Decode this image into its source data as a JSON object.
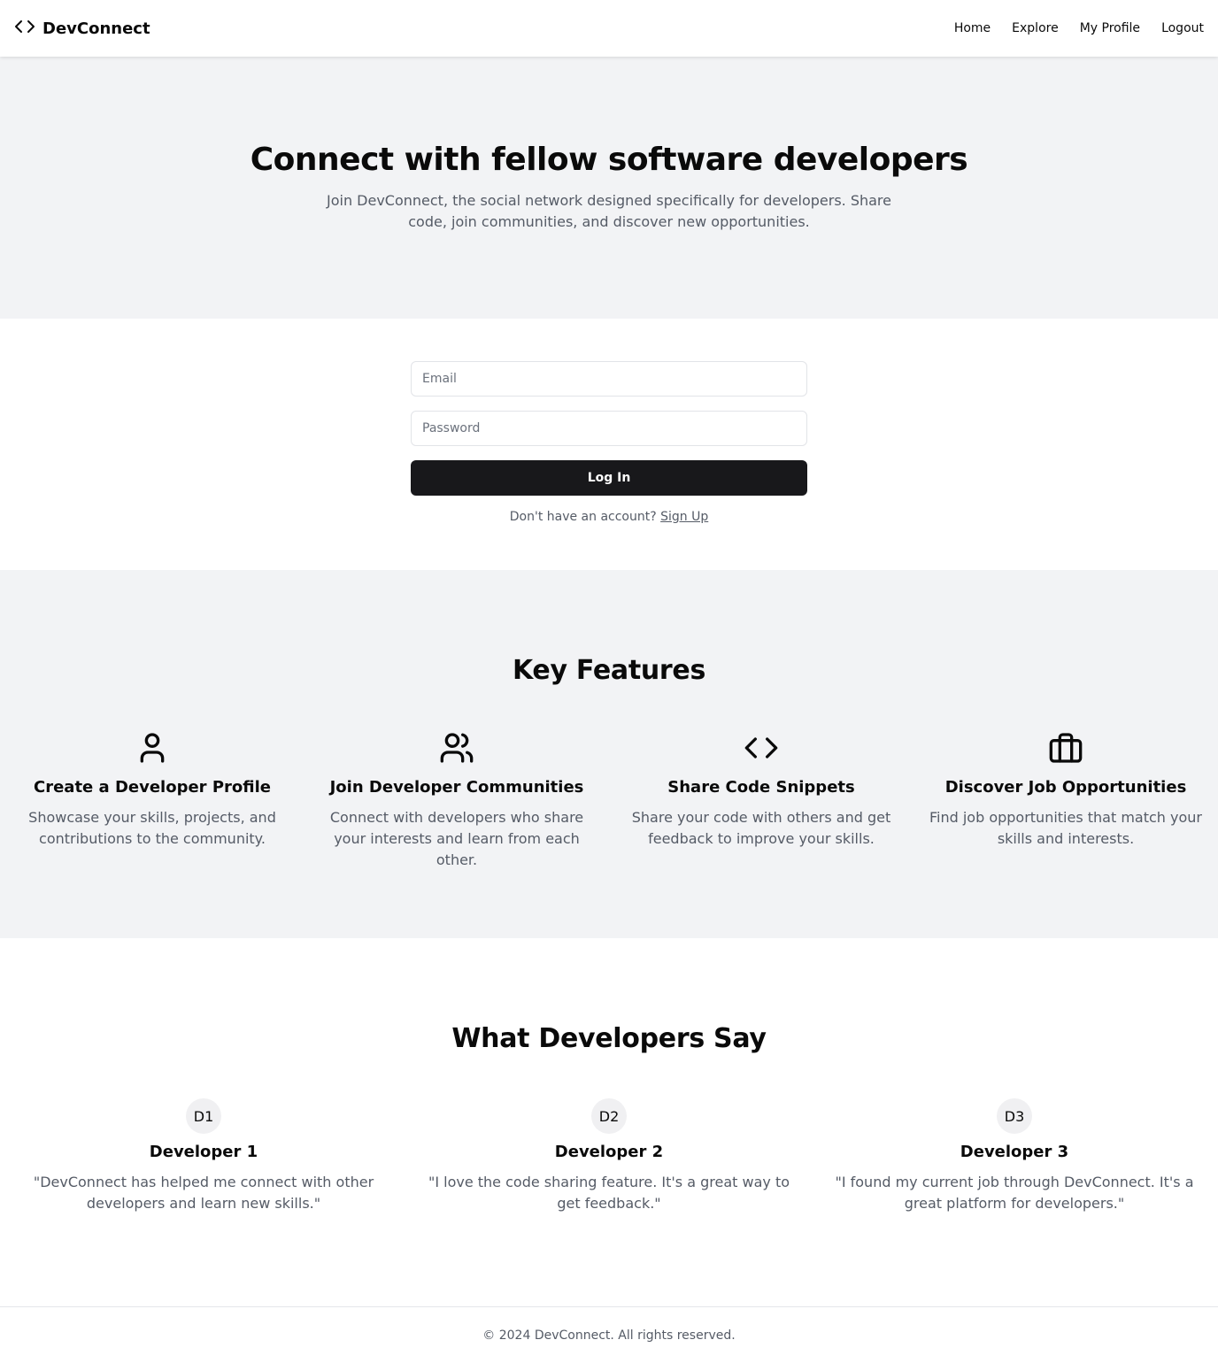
{
  "header": {
    "brand": "DevConnect",
    "brand_icon": "code-icon",
    "nav": [
      {
        "label": "Home"
      },
      {
        "label": "Explore"
      },
      {
        "label": "My Profile"
      },
      {
        "label": "Logout"
      }
    ]
  },
  "hero": {
    "title": "Connect with fellow software developers",
    "subtitle": "Join DevConnect, the social network designed specifically for developers. Share code, join communities, and discover new opportunities."
  },
  "login": {
    "email_placeholder": "Email",
    "email_value": "",
    "password_placeholder": "Password",
    "password_value": "",
    "submit_label": "Log In",
    "signup_prompt": "Don't have an account?",
    "signup_link": "Sign Up"
  },
  "features": {
    "title": "Key Features",
    "items": [
      {
        "icon": "user-icon",
        "title": "Create a Developer Profile",
        "text": "Showcase your skills, projects, and contributions to the community."
      },
      {
        "icon": "users-icon",
        "title": "Join Developer Communities",
        "text": "Connect with developers who share your interests and learn from each other."
      },
      {
        "icon": "code-icon",
        "title": "Share Code Snippets",
        "text": "Share your code with others and get feedback to improve your skills."
      },
      {
        "icon": "briefcase-icon",
        "title": "Discover Job Opportunities",
        "text": "Find job opportunities that match your skills and interests."
      }
    ]
  },
  "testimonials": {
    "title": "What Developers Say",
    "items": [
      {
        "initials": "D1",
        "name": "Developer 1",
        "quote": "\"DevConnect has helped me connect with other developers and learn new skills.\""
      },
      {
        "initials": "D2",
        "name": "Developer 2",
        "quote": "\"I love the code sharing feature. It's a great way to get feedback.\""
      },
      {
        "initials": "D3",
        "name": "Developer 3",
        "quote": "\"I found my current job through DevConnect. It's a great platform for developers.\""
      }
    ]
  },
  "footer": {
    "copyright": "© 2024 DevConnect. All rights reserved."
  },
  "colors": {
    "primary_button": "#18181b",
    "section_alt_bg": "#f2f3f5",
    "muted_text": "#555b66"
  }
}
